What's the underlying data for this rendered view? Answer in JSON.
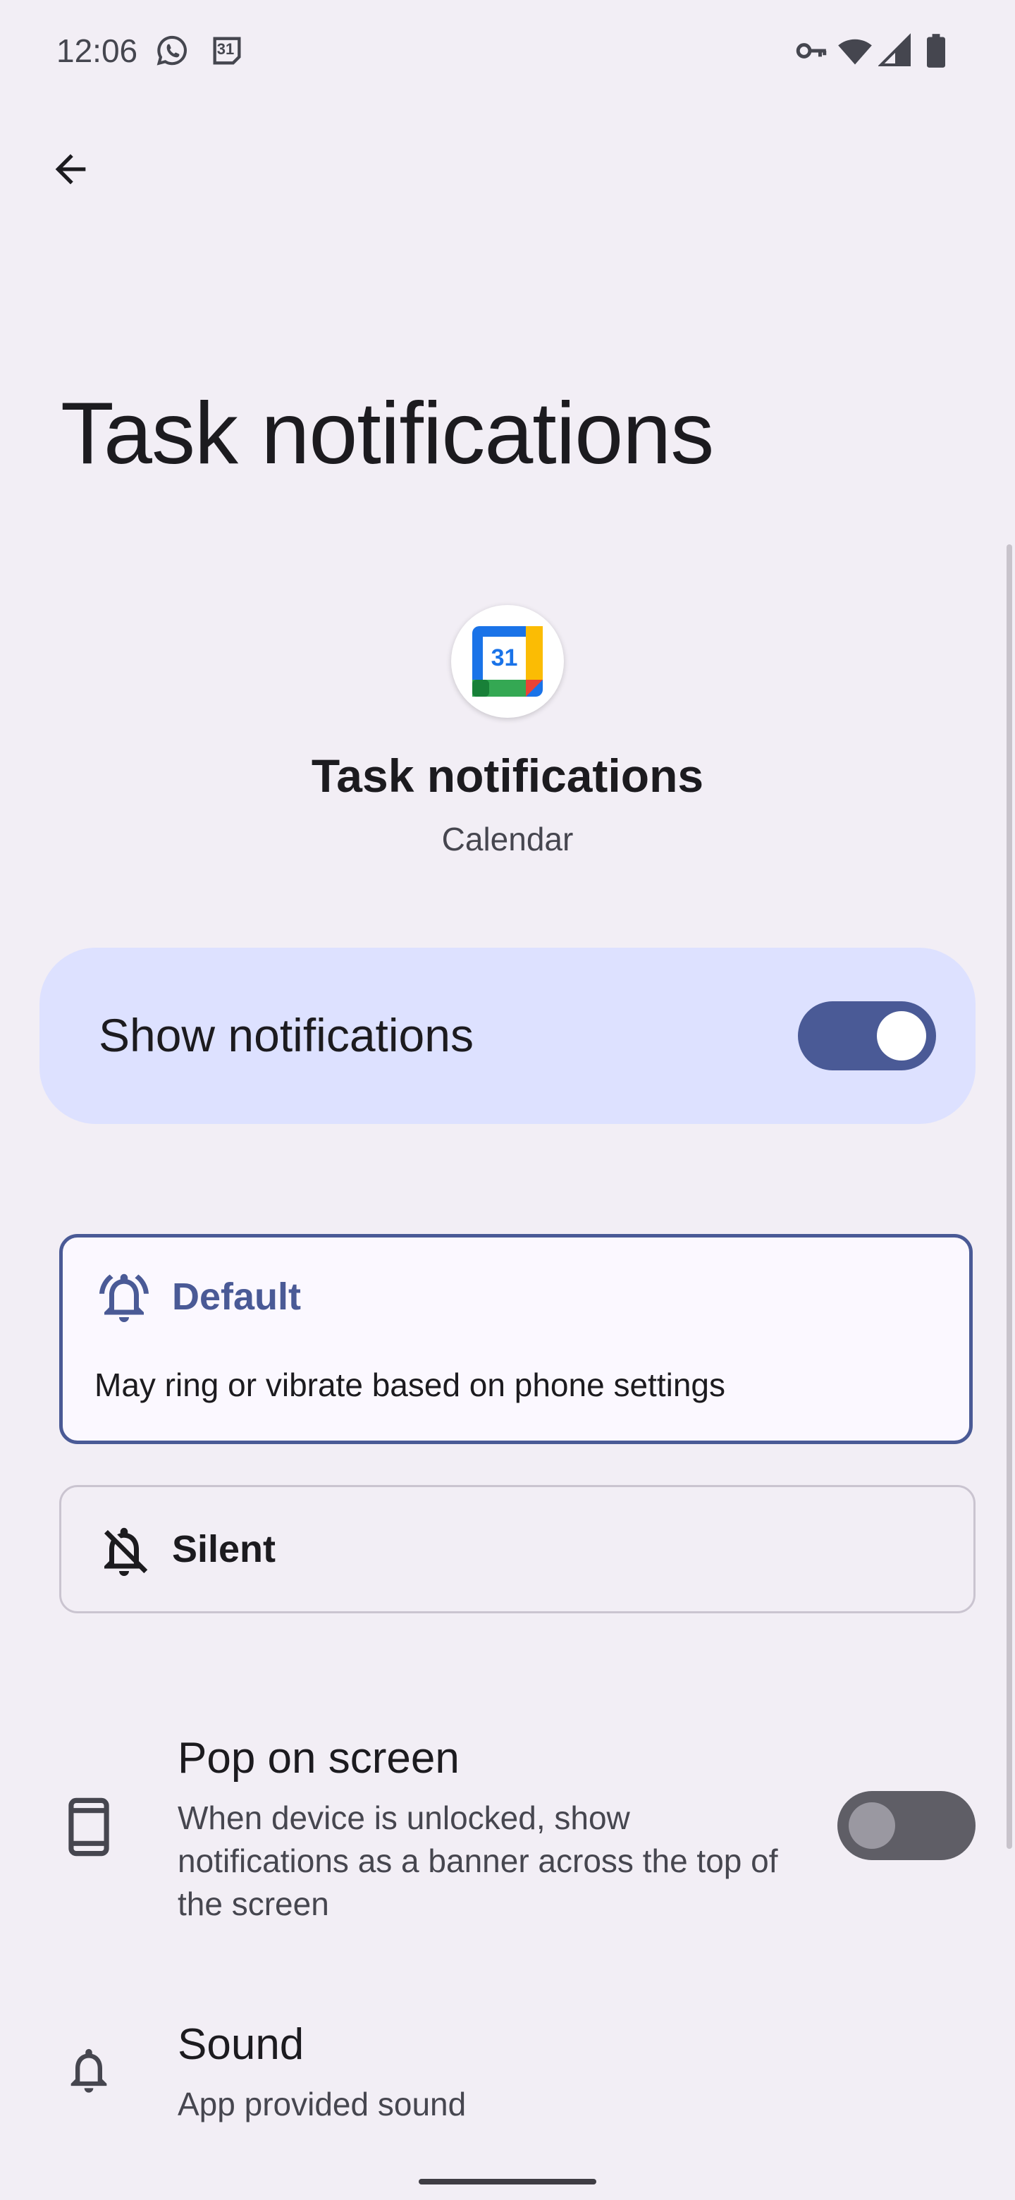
{
  "status_bar": {
    "time": "12:06",
    "left_icons": [
      "whatsapp-icon",
      "calendar-31-icon"
    ],
    "right_icons": [
      "vpn-key-icon",
      "wifi-icon",
      "signal-icon",
      "battery-icon"
    ],
    "calendar_badge": "31"
  },
  "header": {
    "back_icon": "arrow-back-icon",
    "page_title": "Task notifications"
  },
  "channel": {
    "title": "Task notifications",
    "app_name": "Calendar",
    "app_icon_badge": "31"
  },
  "show_notifications": {
    "label": "Show notifications",
    "enabled": true
  },
  "importance": {
    "default": {
      "title": "Default",
      "description": "May ring or vibrate based on phone settings",
      "selected": true,
      "icon": "bell-ring-icon"
    },
    "silent": {
      "title": "Silent",
      "selected": false,
      "icon": "bell-off-icon"
    }
  },
  "pop_on_screen": {
    "title": "Pop on screen",
    "description": "When device is unlocked, show notifications as a banner across the top of the screen",
    "enabled": false,
    "icon": "phone-icon"
  },
  "sound": {
    "title": "Sound",
    "value": "App provided sound",
    "icon": "bell-icon"
  },
  "colors": {
    "background": "#f2eef5",
    "accent": "#4a5a96",
    "card": "#dde1ff"
  }
}
